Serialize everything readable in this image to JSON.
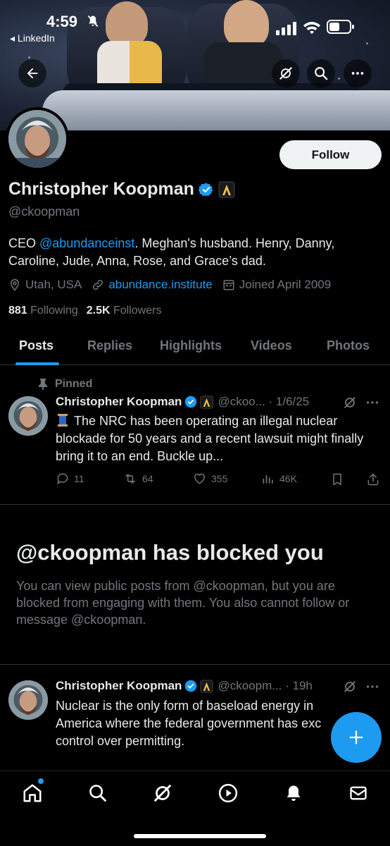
{
  "status_bar": {
    "time": "4:59",
    "back_app": "◂ LinkedIn"
  },
  "profile": {
    "name": "Christopher Koopman",
    "handle": "@ckoopman",
    "follow_label": "Follow",
    "bio_prefix": "CEO ",
    "bio_link": "@abundanceinst",
    "bio_suffix": ". Meghan's husband. Henry, Danny, Caroline, Jude, Anna, Rose, and Grace’s dad.",
    "location": "Utah, USA",
    "website": "abundance.institute",
    "joined": "Joined April 2009",
    "following_count": "881",
    "following_label": "Following",
    "followers_count": "2.5K",
    "followers_label": "Followers"
  },
  "tabs": [
    {
      "label": "Posts"
    },
    {
      "label": "Replies"
    },
    {
      "label": "Highlights"
    },
    {
      "label": "Videos"
    },
    {
      "label": "Photos"
    }
  ],
  "pinned_post": {
    "pinned_label": "Pinned",
    "author": "Christopher Koopman",
    "meta": "@ckoo... · 1/6/25",
    "text": "The NRC has been operating an illegal nuclear blockade for 50 years and a recent lawsuit might finally bring it to an end. Buckle up...",
    "replies": "11",
    "reposts": "64",
    "likes": "355",
    "views": "46K"
  },
  "blocked": {
    "title": "@ckoopman has blocked you",
    "text": "You can view public posts from @ckoopman, but you are blocked from engaging with them. You also cannot follow or message @ckoopman."
  },
  "second_post": {
    "author": "Christopher Koopman",
    "meta": "@ckoopm... · 19h",
    "text": "Nuclear is the only form of baseload energy in America where the federal government has exc control over permitting."
  },
  "colors": {
    "accent": "#1d9bf0",
    "background": "#000000",
    "muted": "#71767b"
  }
}
